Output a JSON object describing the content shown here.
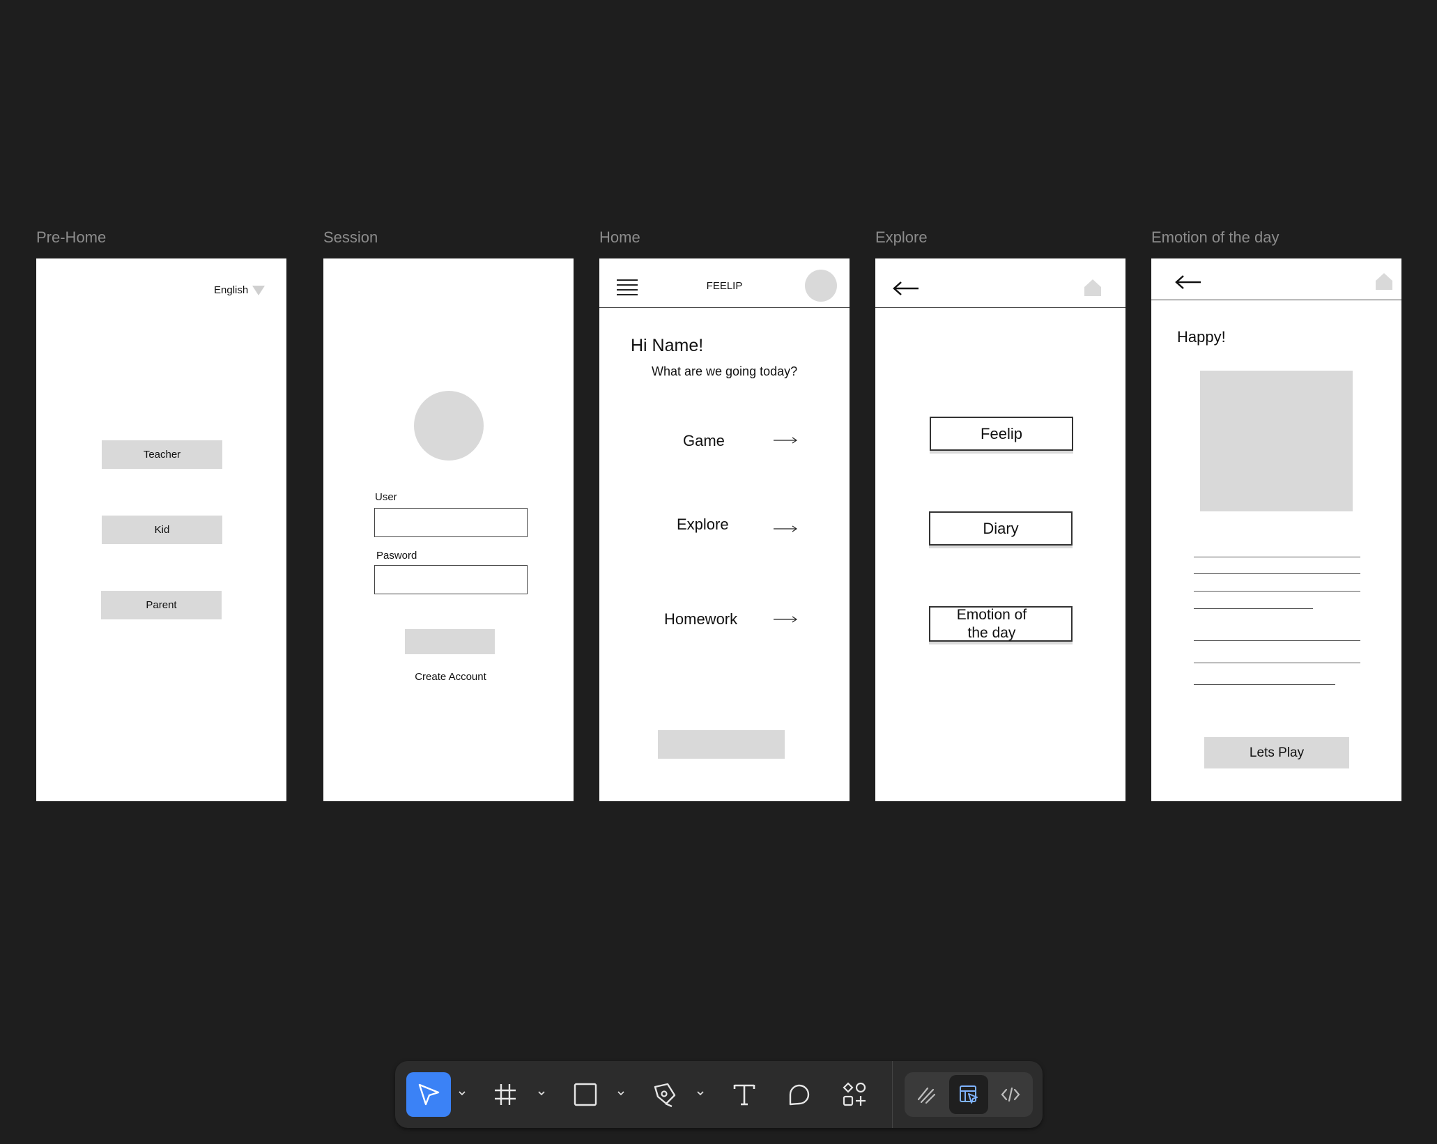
{
  "frames": [
    {
      "title": "Pre-Home"
    },
    {
      "title": "Session"
    },
    {
      "title": "Home"
    },
    {
      "title": "Explore"
    },
    {
      "title": "Emotion of the day"
    }
  ],
  "prehome": {
    "language": "English",
    "buttons": [
      "Teacher",
      "Kid",
      "Parent"
    ]
  },
  "session": {
    "user_label": "User",
    "password_label": "Pasword",
    "create_account": "Create Account"
  },
  "home": {
    "brand": "FEELIP",
    "greeting": "Hi Name!",
    "subtitle": "What are we going today?",
    "items": [
      "Game",
      "Explore",
      "Homework"
    ]
  },
  "explore": {
    "buttons": [
      "Feelip",
      "Diary",
      "Emotion of the day"
    ]
  },
  "emotion": {
    "title": "Happy!",
    "play_button": "Lets Play"
  },
  "toolbar": {
    "tools": [
      "move-tool",
      "frame-tool",
      "rectangle-tool",
      "pen-tool",
      "text-tool",
      "comment-tool",
      "actions-tool"
    ],
    "modes": [
      "draw-mode",
      "design-mode",
      "dev-mode"
    ],
    "active_tool": "move-tool",
    "active_mode": "design-mode",
    "accent": "#3b82f6"
  }
}
